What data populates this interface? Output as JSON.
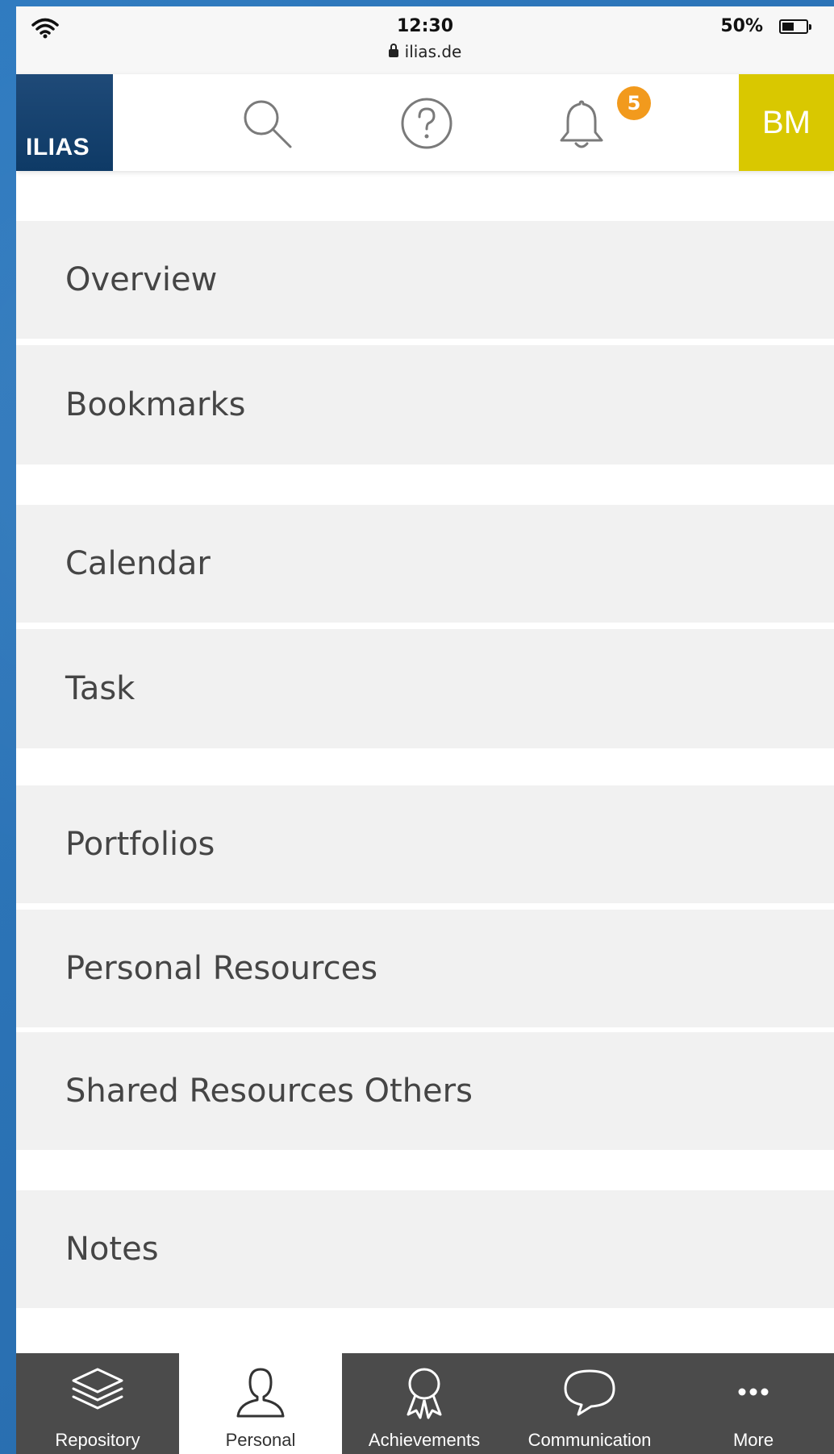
{
  "status_bar": {
    "time": "12:30",
    "url": "ilias.de",
    "battery_percent_text": "50%",
    "battery_level": 0.5
  },
  "header": {
    "logo_text": "ILIAS",
    "notification_count": "5",
    "avatar_initials": "BM",
    "colors": {
      "logo_bg": "#0e3a66",
      "avatar_bg": "#d9c800",
      "badge_bg": "#f29a1d"
    }
  },
  "menu": {
    "items": [
      {
        "label": "Overview"
      },
      {
        "label": "Bookmarks"
      },
      {
        "label": "Calendar"
      },
      {
        "label": "Task"
      },
      {
        "label": "Portfolios"
      },
      {
        "label": "Personal Resources"
      },
      {
        "label": "Shared Resources Others"
      },
      {
        "label": "Notes"
      }
    ]
  },
  "bottom_nav": {
    "items": [
      {
        "label": "Repository",
        "icon": "layers-icon"
      },
      {
        "label": "Personal",
        "icon": "person-icon",
        "active": true
      },
      {
        "label": "Achievements",
        "icon": "award-icon"
      },
      {
        "label": "Communication",
        "icon": "speech-bubble-icon"
      },
      {
        "label": "More",
        "icon": "more-dots-icon"
      }
    ]
  }
}
